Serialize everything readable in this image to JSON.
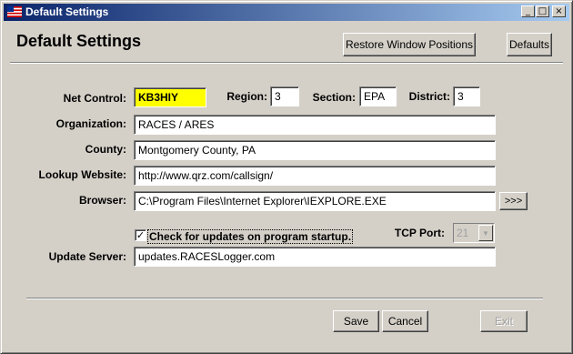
{
  "window": {
    "title": "Default Settings",
    "minimize": "_",
    "maximize": "□",
    "close": "×"
  },
  "heading": "Default Settings",
  "buttons": {
    "restore": "Restore Window Positions",
    "defaults": "Defaults",
    "browse": ">>>",
    "save": "Save",
    "cancel": "Cancel",
    "exit": "Exit"
  },
  "form": {
    "net_control_label": "Net Control:",
    "net_control_value": "KB3HIY",
    "region_label": "Region:",
    "region_value": "3",
    "section_label": "Section:",
    "section_value": "EPA",
    "district_label": "District:",
    "district_value": "3",
    "organization_label": "Organization:",
    "organization_value": "RACES / ARES",
    "county_label": "County:",
    "county_value": "Montgomery County, PA",
    "lookup_label": "Lookup Website:",
    "lookup_value": "http://www.qrz.com/callsign/",
    "browser_label": "Browser:",
    "browser_value": "C:\\Program Files\\Internet Explorer\\IEXPLORE.EXE",
    "check_updates_label": "Check for updates on program startup.",
    "check_updates_checked": true,
    "tcp_port_label": "TCP Port:",
    "tcp_port_value": "21",
    "update_server_label": "Update Server:",
    "update_server_value": "updates.RACESLogger.com"
  }
}
